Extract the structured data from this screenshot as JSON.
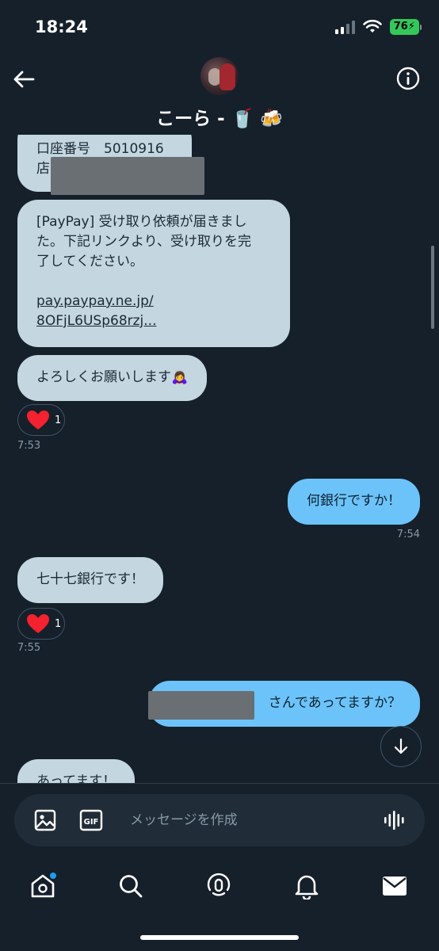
{
  "status_bar": {
    "time": "18:24",
    "battery": "76"
  },
  "header": {
    "contact_name": "こーら - 🥤 🍻"
  },
  "messages": {
    "m1_line1": "口座番号　5010916",
    "m1_line2": "店",
    "m2_line1": "[PayPay] 受け取り依頼が届きまし",
    "m2_line2": "た。下記リンクより、受け取りを完",
    "m2_line3": "了してください。",
    "m2_link1": "pay.paypay.ne.jp/",
    "m2_link2": "8OFjL6USp68rzj...",
    "m3_text": "よろしくお願いします🙇‍♀️",
    "m3_reaction_count": "1",
    "m3_time": "7:53",
    "m4_text": "何銀行ですか！",
    "m4_time": "7:54",
    "m5_text": "七十七銀行です！",
    "m5_reaction_count": "1",
    "m5_time": "7:55",
    "m6_text": "さんであってますか？",
    "m7_text": "あってます！"
  },
  "composer": {
    "placeholder": "メッセージを作成",
    "gif_label": "GIF"
  },
  "colors": {
    "background": "#15202b",
    "incoming_bubble": "#c4d6e0",
    "outgoing_bubble": "#6cc3f9",
    "reaction_heart": "#f4212e",
    "notification_dot": "#1d9bf0"
  },
  "icons": {
    "header": [
      "back-arrow-icon",
      "info-icon"
    ],
    "composer": [
      "image-icon",
      "gif-icon",
      "voice-icon"
    ],
    "tabs": [
      "home-icon",
      "search-icon",
      "spaces-icon",
      "bell-icon",
      "mail-icon"
    ]
  }
}
